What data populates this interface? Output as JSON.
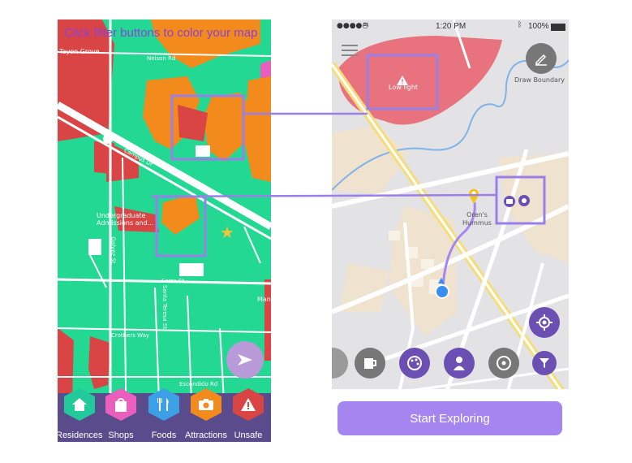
{
  "left_screen": {
    "banner": "Click filter buttons to color your map",
    "map_labels": {
      "area": "Tayon Grove",
      "road1": "Nelson Rd",
      "road2": "Campus Dr",
      "building": "Undergraduate Admissions and...",
      "street3": "Serra St",
      "street4": "Galvez St",
      "street5": "Escondido Rd",
      "street6": "Santa Teresa St",
      "street7": "Crothers Way",
      "edge": "Man"
    },
    "filters": [
      {
        "label": "Residences",
        "icon": "home-icon",
        "color": "#22c99a"
      },
      {
        "label": "Shops",
        "icon": "bag-icon",
        "color": "#ea5fbd"
      },
      {
        "label": "Foods",
        "icon": "fork-knife-icon",
        "color": "#3ba0e6"
      },
      {
        "label": "Attractions",
        "icon": "camera-icon",
        "color": "#f28a1c"
      },
      {
        "label": "Unsafe",
        "icon": "warning-icon",
        "color": "#d94545"
      }
    ]
  },
  "right_screen": {
    "status": {
      "carrier": "●●●●○",
      "time": "1:20 PM",
      "battery": "100%"
    },
    "draw_boundary_label": "Draw Boundary",
    "low_light_label": "Low light",
    "pin_label": "Oren's Hummus",
    "start_button": "Start Exploring"
  },
  "colors": {
    "green": "#23d892",
    "orange": "#f28a1c",
    "red": "#d94545",
    "pink": "#ea5fbd",
    "purple": "#6b4fb3",
    "lavender": "#a88ef0",
    "connector": "#9b7fe8"
  }
}
